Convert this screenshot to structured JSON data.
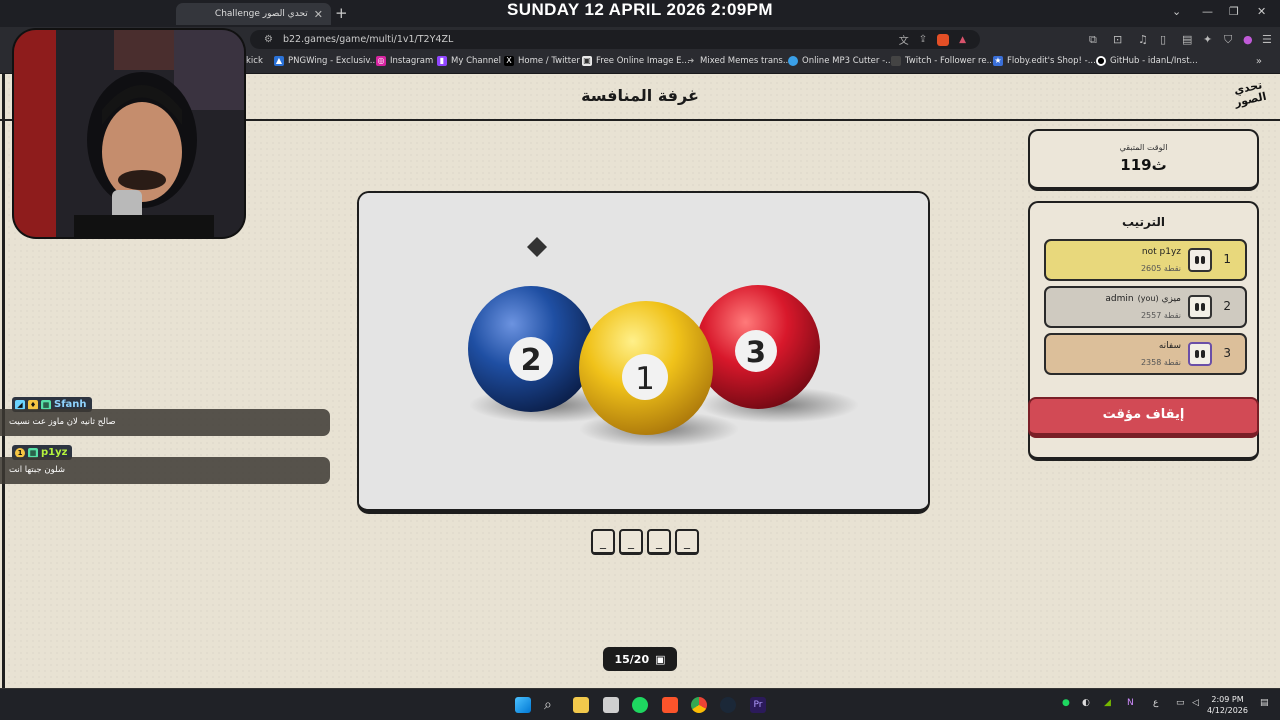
{
  "overlay_date": "SUNDAY 12 APRIL 2026 2:09PM",
  "browser": {
    "tab_title": "تحدي الصور Challenge",
    "url": "b22.games/game/multi/1v1/T2Y4ZL",
    "bookmarks": [
      {
        "label": "kick",
        "icon": "kick-icon",
        "color": "#53fc18"
      },
      {
        "label": "PNGWing - Exclusiv...",
        "icon": "pngwing-icon",
        "color": "#2a72d8"
      },
      {
        "label": "Instagram",
        "icon": "instagram-icon",
        "color": "#d6249f"
      },
      {
        "label": "My Channel",
        "icon": "twitch-icon",
        "color": "#9146ff"
      },
      {
        "label": "Home / Twitter",
        "icon": "x-icon",
        "color": "#000000"
      },
      {
        "label": "Free Online Image E...",
        "icon": "image-editor-icon",
        "color": "#e9e9e9"
      },
      {
        "label": "Mixed Memes trans...",
        "icon": "arrow-icon",
        "color": "#777777"
      },
      {
        "label": "Online MP3 Cutter -...",
        "icon": "mp3-cutter-icon",
        "color": "#3aa0e8"
      },
      {
        "label": "Twitch - Follower re...",
        "icon": "page-icon",
        "color": "#444444"
      },
      {
        "label": "Floby.edit's Shop! -...",
        "icon": "shop-icon",
        "color": "#3a6fd8"
      },
      {
        "label": "GitHub - idanL/Inst...",
        "icon": "github-icon",
        "color": "#ffffff"
      }
    ]
  },
  "page": {
    "title": "غرفة المنافسة",
    "logo_text": "تحدي الصور",
    "timer": {
      "label": "الوقت المتبقي",
      "value": "119ث"
    },
    "ranking": {
      "title": "الترتيب",
      "rows": [
        {
          "rank": "1",
          "name": "not p1yz",
          "you": "",
          "score": "2605 نقطة",
          "color": "#e8d87c"
        },
        {
          "rank": "2",
          "name": "ميزي",
          "you": "(you)",
          "name_suffix": "admin",
          "score": "2557 نقطة",
          "color": "#cfcac0"
        },
        {
          "rank": "3",
          "name": "سفانه",
          "you": "",
          "score": "2358 نقطة",
          "color": "#dcbf9a"
        }
      ]
    },
    "pause_label": "إيقاف مؤقت",
    "answer_slots": [
      "_",
      "_",
      "_",
      "_"
    ],
    "round": "15/20",
    "balls": [
      {
        "number": "2",
        "color": "#1f4fa3"
      },
      {
        "number": "1",
        "color": "#f0c21a"
      },
      {
        "number": "3",
        "color": "#d8182b"
      }
    ]
  },
  "chat": [
    {
      "user": "Sfanh",
      "message": "صالح ثانيه لان ماوز عت نسيت",
      "user_color": "#8fd3ff"
    },
    {
      "user": "p1yz",
      "message": "شلون جبتها انت",
      "user_color": "#b6f23c"
    }
  ],
  "clock": {
    "time": "2:09 PM",
    "date": "4/12/2026"
  }
}
